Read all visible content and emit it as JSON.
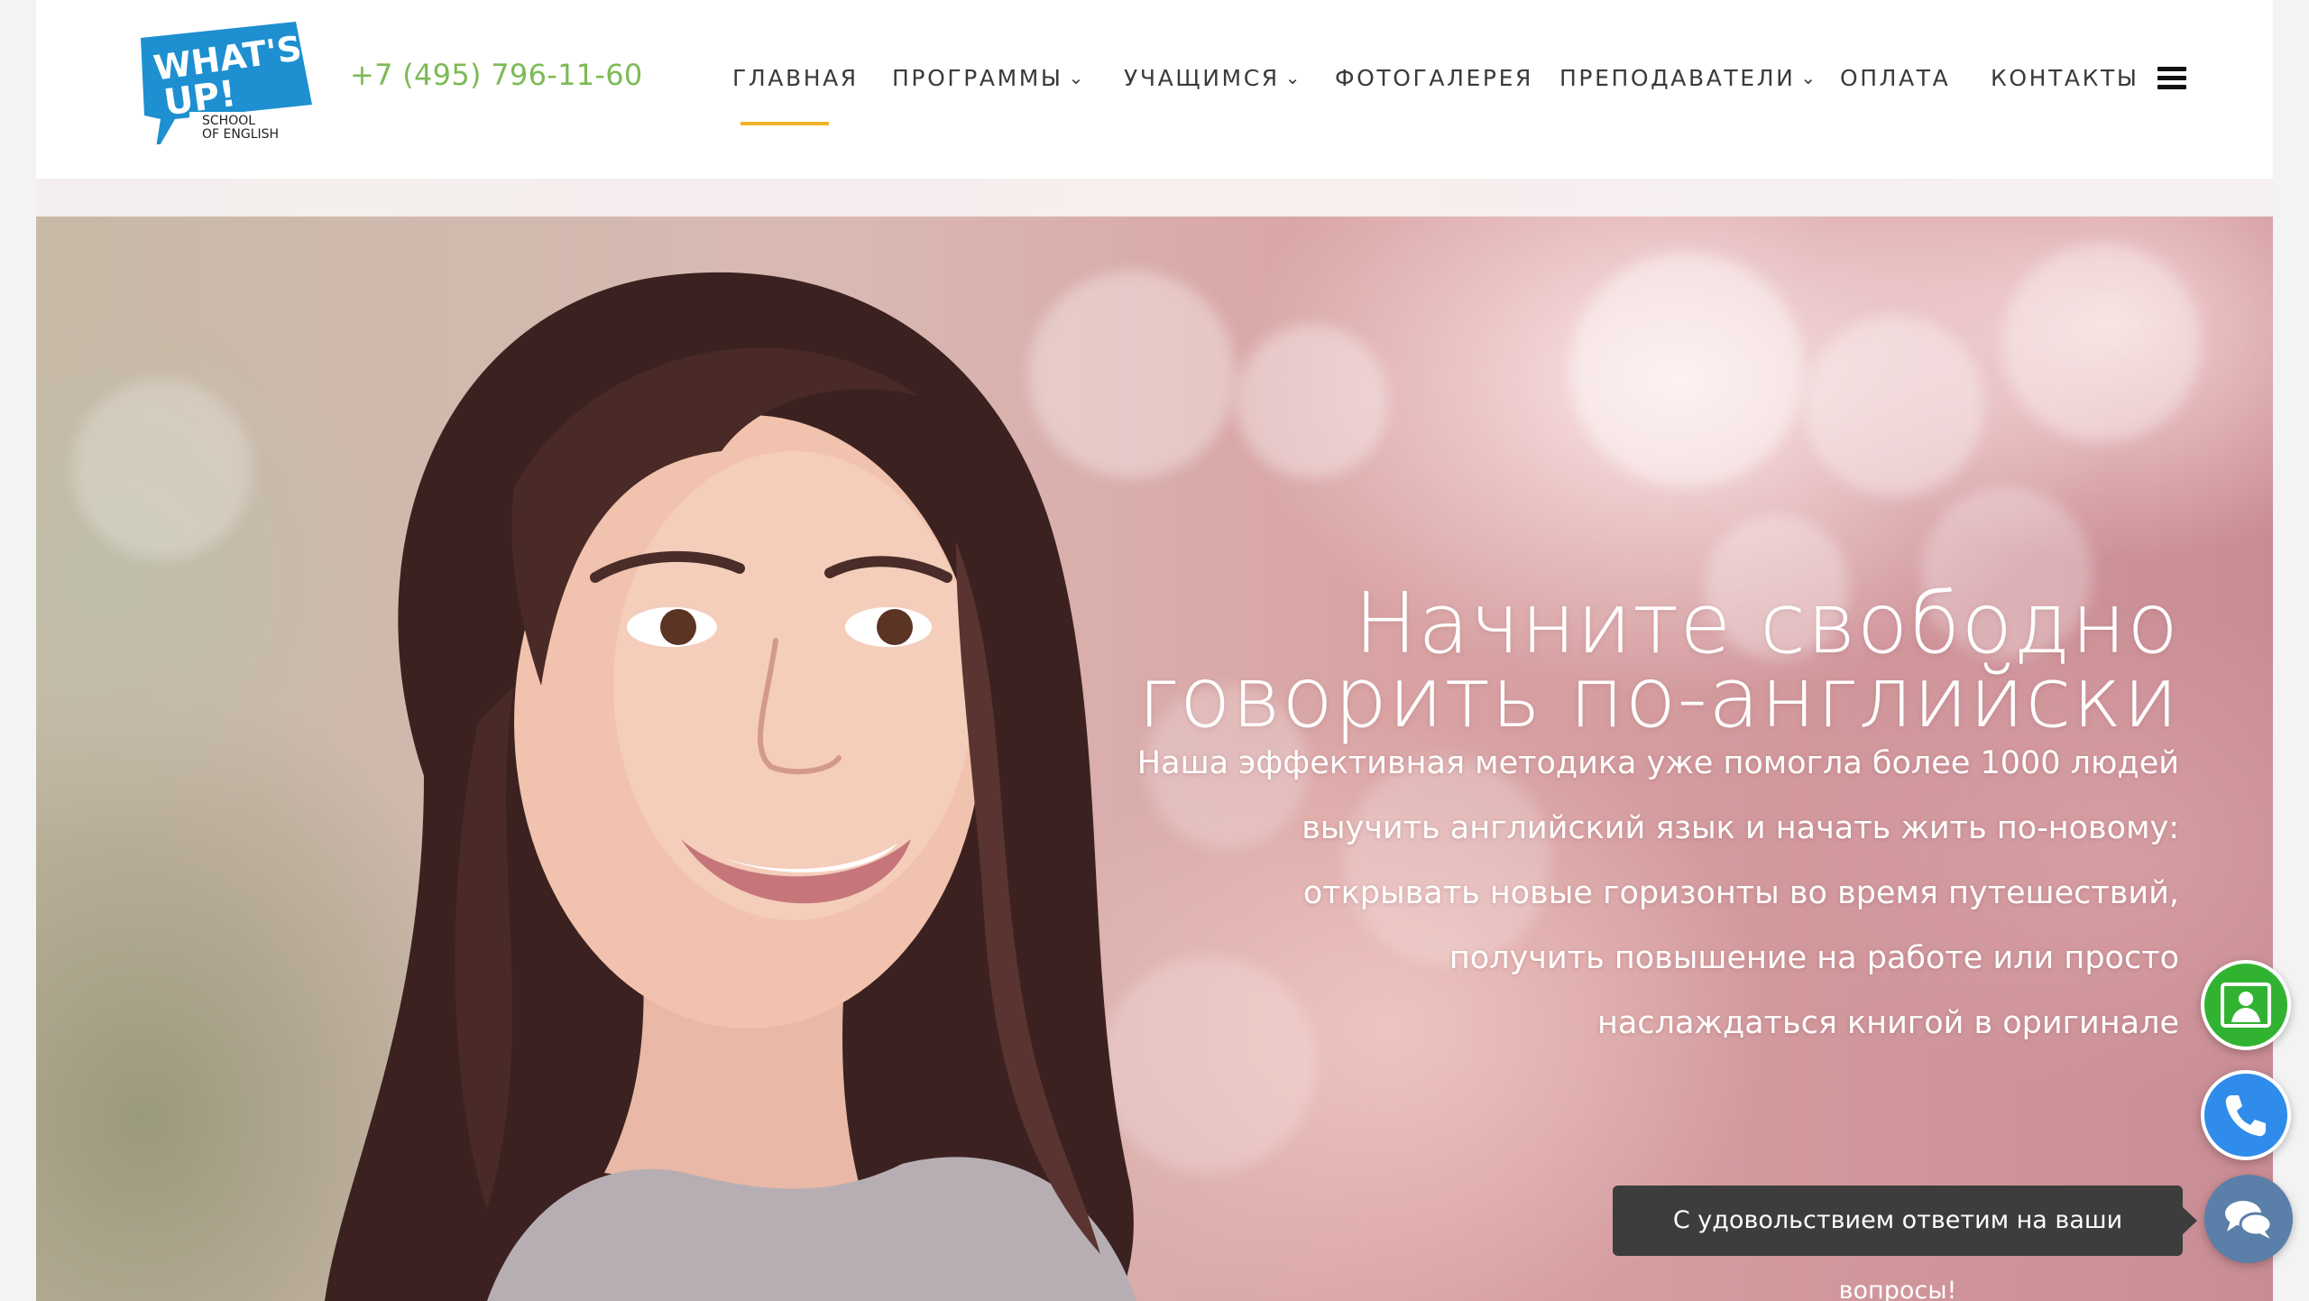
{
  "header": {
    "logo": {
      "line1": "WHAT'S",
      "line2": "UP!",
      "sub1": "SCHOOL",
      "sub2": "OF ENGLISH",
      "color": "#1e8fd0"
    },
    "phone": "+7 (495) 796-11-60",
    "nav": [
      {
        "label": "ГЛАВНАЯ",
        "dropdown": false,
        "active": true
      },
      {
        "label": "ПРОГРАММЫ",
        "dropdown": true
      },
      {
        "label": "УЧАЩИМСЯ",
        "dropdown": true
      },
      {
        "label": "ФОТОГАЛЕРЕЯ",
        "dropdown": false
      },
      {
        "label": "ПРЕПОДАВАТЕЛИ",
        "dropdown": true
      },
      {
        "label": "ОПЛАТА",
        "dropdown": false
      },
      {
        "label": "КОНТАКТЫ",
        "dropdown": false
      }
    ],
    "menu_icon": "hamburger-icon",
    "accent_color": "#f4b228",
    "phone_color": "#7dba55"
  },
  "hero": {
    "title_line1": "Начните свободно",
    "title_line2": "говорить по-английски",
    "text_lines": [
      "Наша эффективная методика уже помогла более 1000 людей",
      "выучить английский язык и начать жить по-новому:",
      "открывать новые горизонты во время путешествий,",
      "получить повышение на работе или просто",
      "наслаждаться книгой в оригинале"
    ]
  },
  "widgets": {
    "green_button_icon": "contact-card-icon",
    "blue_button_icon": "phone-icon",
    "chat_button_icon": "chat-bubbles-icon",
    "tooltip": "С удовольствием ответим на ваши вопросы!",
    "green": "#31b331",
    "blue": "#2f8cea",
    "chat": "#5a7fa8"
  }
}
